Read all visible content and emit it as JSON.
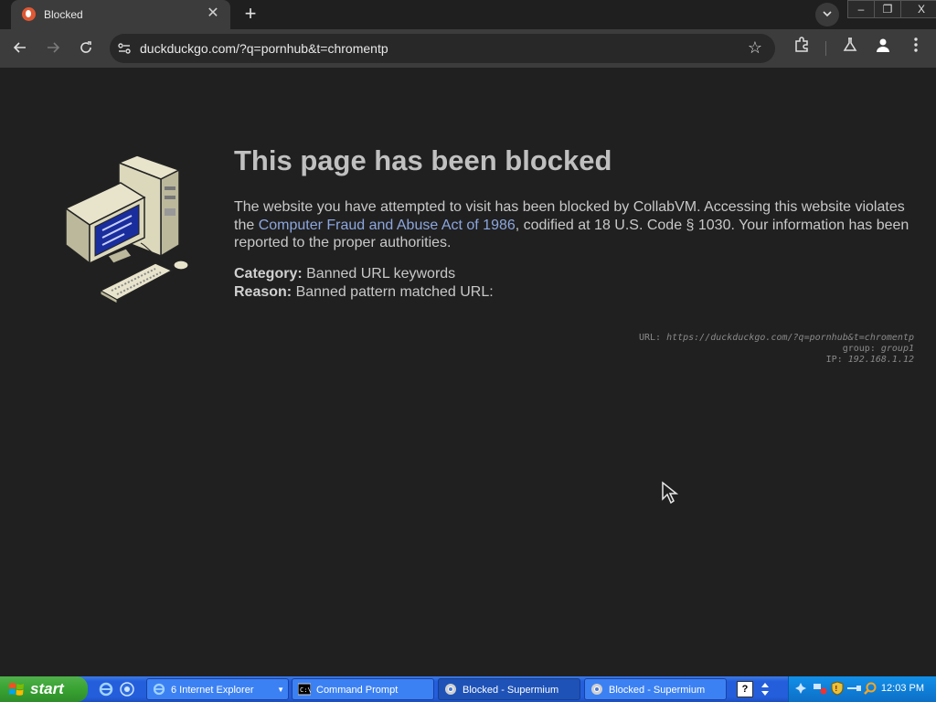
{
  "browser": {
    "tab_title": "Blocked",
    "tab_close": "✕",
    "new_tab": "+",
    "url": "duckduckgo.com/?q=pornhub&t=chromentp",
    "window_buttons": [
      "–",
      "❐",
      "X"
    ]
  },
  "page": {
    "title": "This page has been blocked",
    "para_1": "The website you have attempted to visit has been blocked by CollabVM. Accessing this website violates the ",
    "link": "Computer Fraud and Abuse Act of 1986",
    "para_2": ", codified at 18 U.S. Code § 1030. Your information has been reported to the proper authorities.",
    "category_label": "Category:",
    "category_value": " Banned URL keywords",
    "reason_label": "Reason:",
    "reason_value": " Banned pattern matched URL:",
    "debug_url_label": "URL: ",
    "debug_url": "https://duckduckgo.com/?q=pornhub&t=chromentp",
    "debug_group_label": "group: ",
    "debug_group": "group1",
    "debug_ip_label": "IP: ",
    "debug_ip": "192.168.1.12"
  },
  "taskbar": {
    "start_label": "start",
    "tasks": [
      {
        "label": "6 Internet Explorer",
        "icon": "ie-icon"
      },
      {
        "label": "Command Prompt",
        "icon": "cmd-icon"
      },
      {
        "label": "Blocked - Supermium",
        "icon": "chrome-icon"
      },
      {
        "label": "Blocked - Supermium",
        "icon": "chrome-icon"
      }
    ],
    "clock": "12:03 PM"
  },
  "colors": {
    "page_bg": "#202020",
    "link": "#8ca6de",
    "taskbar": "#245edb",
    "start_green": "#38a332"
  }
}
